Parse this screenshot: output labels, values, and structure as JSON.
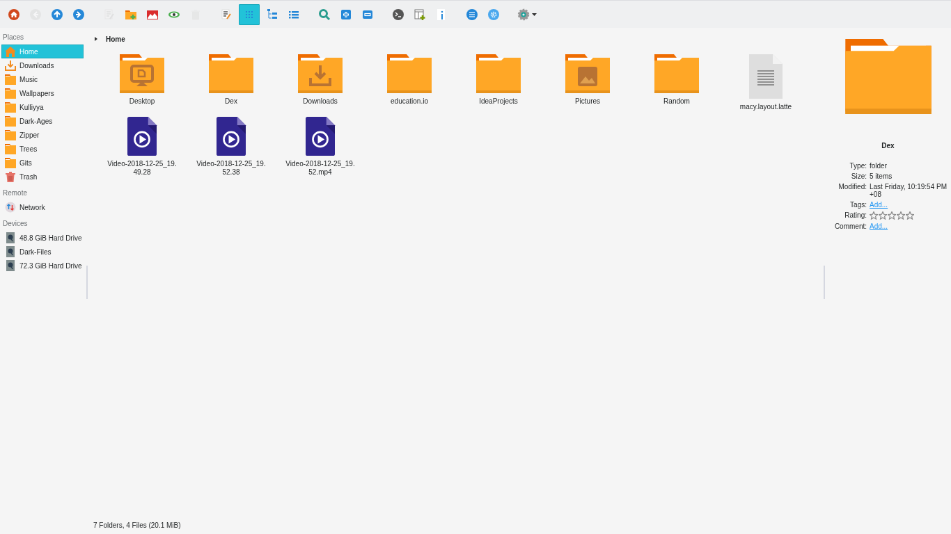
{
  "toolbar": [
    {
      "kind": "home",
      "disabled": false
    },
    {
      "kind": "back",
      "disabled": true
    },
    {
      "kind": "up",
      "disabled": false
    },
    {
      "kind": "forward",
      "disabled": false
    },
    {
      "kind": "sep"
    },
    {
      "kind": "rename",
      "disabled": true
    },
    {
      "kind": "new-folder",
      "disabled": false
    },
    {
      "kind": "image",
      "disabled": false
    },
    {
      "kind": "preview",
      "disabled": false
    },
    {
      "kind": "trash",
      "disabled": true
    },
    {
      "kind": "sep"
    },
    {
      "kind": "edit",
      "disabled": false
    }
  ],
  "view_modes": [
    {
      "kind": "icons",
      "selected": true
    },
    {
      "kind": "compact",
      "selected": false
    },
    {
      "kind": "details",
      "selected": false
    }
  ],
  "toolbar_right": [
    {
      "kind": "search"
    },
    {
      "kind": "zoom-in"
    },
    {
      "kind": "zoom-out"
    },
    {
      "kind": "sep"
    },
    {
      "kind": "terminal"
    },
    {
      "kind": "split"
    },
    {
      "kind": "info"
    },
    {
      "kind": "sep"
    },
    {
      "kind": "menu-circle"
    },
    {
      "kind": "kde"
    },
    {
      "kind": "sep"
    },
    {
      "kind": "settings"
    }
  ],
  "sidebar": [
    {
      "heading": "Places",
      "items": [
        {
          "label": "Home",
          "kind": "home",
          "selected": true
        },
        {
          "label": "Downloads",
          "kind": "download",
          "selected": false
        },
        {
          "label": "Music",
          "kind": "folder",
          "selected": false
        },
        {
          "label": "Wallpapers",
          "kind": "folder",
          "selected": false
        },
        {
          "label": "Kulliyya",
          "kind": "folder",
          "selected": false
        },
        {
          "label": "Dark-Ages",
          "kind": "folder",
          "selected": false
        },
        {
          "label": "Zipper",
          "kind": "folder",
          "selected": false
        },
        {
          "label": "Trees",
          "kind": "folder",
          "selected": false
        },
        {
          "label": "Gits",
          "kind": "folder",
          "selected": false
        },
        {
          "label": "Trash",
          "kind": "trash",
          "selected": false
        }
      ]
    },
    {
      "heading": "Remote",
      "items": [
        {
          "label": "Network",
          "kind": "network",
          "selected": false
        }
      ]
    },
    {
      "heading": "Devices",
      "items": [
        {
          "label": "48.8 GiB Hard Drive",
          "kind": "drive",
          "selected": false
        },
        {
          "label": "Dark-Files",
          "kind": "drive",
          "selected": false
        },
        {
          "label": "72.3 GiB Hard Drive",
          "kind": "drive",
          "selected": false
        }
      ]
    }
  ],
  "breadcrumb": "Home",
  "files": [
    {
      "name": "Desktop",
      "kind": "folder-desktop"
    },
    {
      "name": "Dex",
      "kind": "folder"
    },
    {
      "name": "Downloads",
      "kind": "folder-download"
    },
    {
      "name": "education.io",
      "kind": "folder"
    },
    {
      "name": "IdeaProjects",
      "kind": "folder"
    },
    {
      "name": "Pictures",
      "kind": "folder-pictures"
    },
    {
      "name": "Random",
      "kind": "folder"
    },
    {
      "name": "macy.layout.latte",
      "kind": "document"
    },
    {
      "name": "Video-2018-12-25_19.49.28",
      "kind": "video"
    },
    {
      "name": "Video-2018-12-25_19.52.38",
      "kind": "video"
    },
    {
      "name": "Video-2018-12-25_19.52.mp4",
      "kind": "video"
    }
  ],
  "info_panel": {
    "title": "Dex",
    "fields": [
      {
        "label": "Type:",
        "kind": "text",
        "value": "folder"
      },
      {
        "label": "Size:",
        "kind": "text",
        "value": "5 items"
      },
      {
        "label": "Modified:",
        "kind": "text",
        "value": "Last Friday, 10:19:54 PM +08"
      },
      {
        "label": "Tags:",
        "kind": "link",
        "value": "Add..."
      },
      {
        "label": "Rating:",
        "kind": "rating",
        "stars": 0
      },
      {
        "label": "Comment:",
        "kind": "link",
        "value": "Add..."
      }
    ]
  },
  "status_bar": "7 Folders, 4 Files (20.1 MiB)"
}
